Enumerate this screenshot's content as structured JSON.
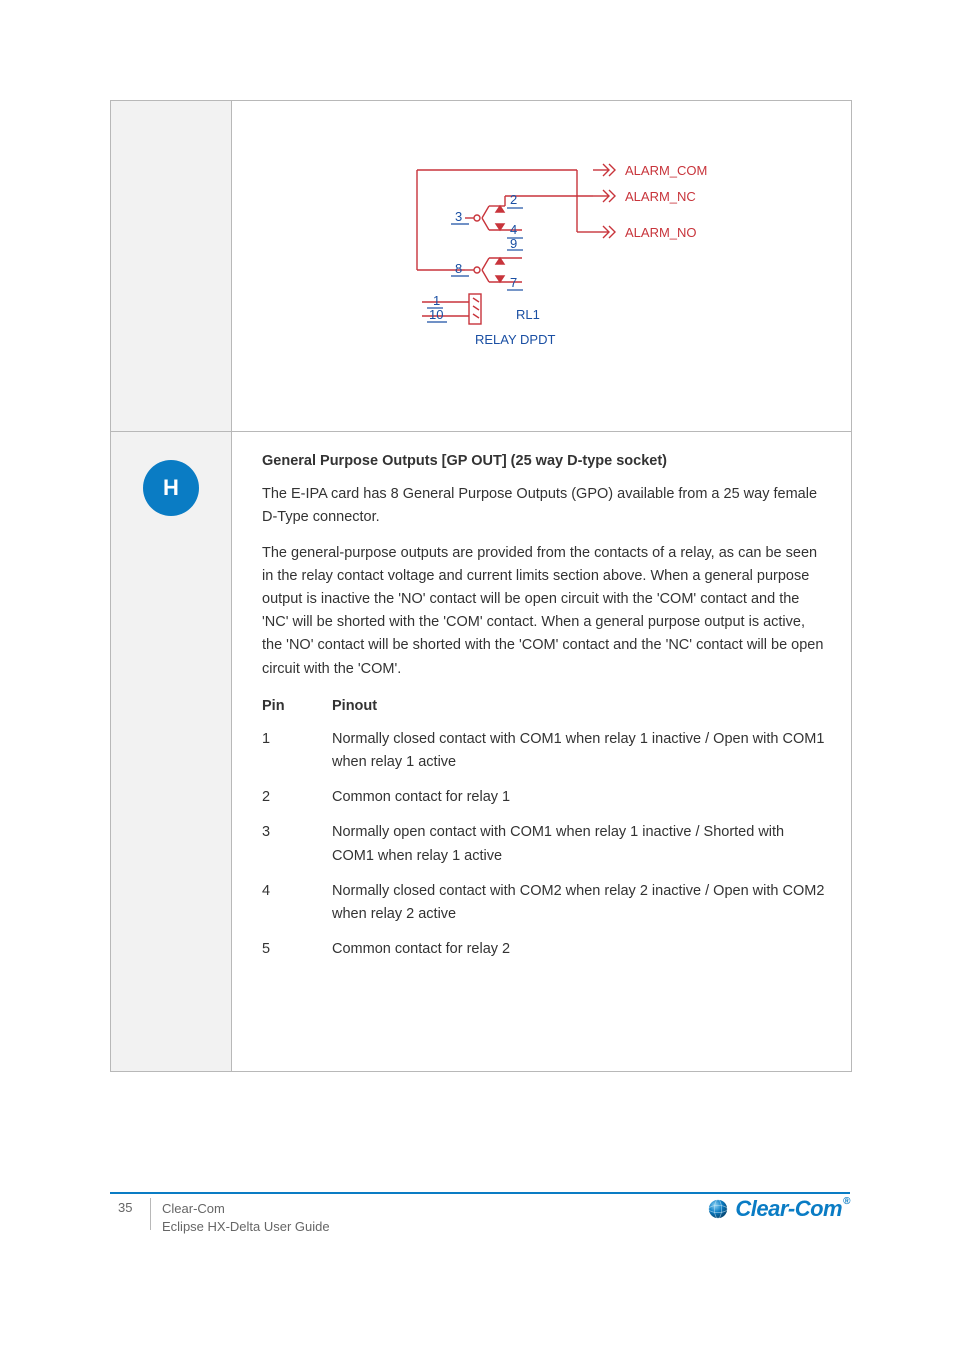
{
  "diagram": {
    "labels": {
      "alarm_com": "ALARM_COM",
      "alarm_nc": "ALARM_NC",
      "alarm_no": "ALARM_NO",
      "rl1": "RL1",
      "relay_dpdt": "RELAY DPDT",
      "n1": "1",
      "n2": "2",
      "n3": "3",
      "n4": "4",
      "n7": "7",
      "n8": "8",
      "n9": "9",
      "n10": "10"
    }
  },
  "key": {
    "badge": "H",
    "heading": "General Purpose Outputs [GP OUT] (25 way D-type socket)",
    "para1": "The E-IPA card has 8 General Purpose Outputs (GPO) available from a 25 way female D-Type connector.",
    "para2": "The general-purpose outputs are provided from the contacts of a relay, as can be seen in the relay contact voltage and current limits section above. When a general purpose output is inactive the 'NO' contact will be open circuit with the 'COM' contact and the 'NC' will be shorted with the 'COM' contact. When a general purpose output is active, the 'NO' contact will be shorted with the 'COM' contact and the 'NC' contact will be open circuit with the 'COM'.",
    "table_header": {
      "pin": "Pin",
      "pinout": "Pinout"
    },
    "rows": [
      {
        "pin": "1",
        "pinout": "Normally closed contact with COM1 when relay 1 inactive / Open with COM1 when relay 1 active"
      },
      {
        "pin": "2",
        "pinout": "Common contact for relay 1"
      },
      {
        "pin": "3",
        "pinout": "Normally open contact with COM1 when relay 1 inactive / Shorted with COM1 when relay 1 active"
      },
      {
        "pin": "4",
        "pinout": "Normally closed contact with COM2 when relay 2 inactive / Open with COM2 when relay 2 active"
      },
      {
        "pin": "5",
        "pinout": "Common contact for relay 2"
      }
    ]
  },
  "footer": {
    "page": "35",
    "line1": "Clear-Com",
    "line2": "Eclipse HX-Delta User Guide",
    "brand": "Clear-Com",
    "reg": "®"
  }
}
